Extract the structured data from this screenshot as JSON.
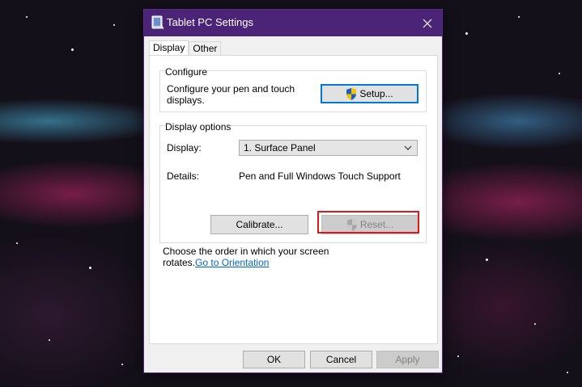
{
  "window": {
    "title": "Tablet PC Settings",
    "title_bar_color": "#4b2377"
  },
  "tabs": [
    {
      "label": "Display",
      "active": true
    },
    {
      "label": "Other",
      "active": false
    }
  ],
  "configure": {
    "group_label": "Configure",
    "description": "Configure your pen and touch displays.",
    "setup_label": "Setup..."
  },
  "display_options": {
    "group_label": "Display options",
    "display_label": "Display:",
    "display_value": "1. Surface Panel",
    "details_label": "Details:",
    "details_value": "Pen and Full Windows Touch Support",
    "calibrate_label": "Calibrate...",
    "reset_label": "Reset..."
  },
  "orientation": {
    "text": "Choose the order in which your screen rotates.",
    "link_text": "Go to Orientation"
  },
  "footer": {
    "ok_label": "OK",
    "cancel_label": "Cancel",
    "apply_label": "Apply"
  },
  "highlight_color": "#d8191e"
}
